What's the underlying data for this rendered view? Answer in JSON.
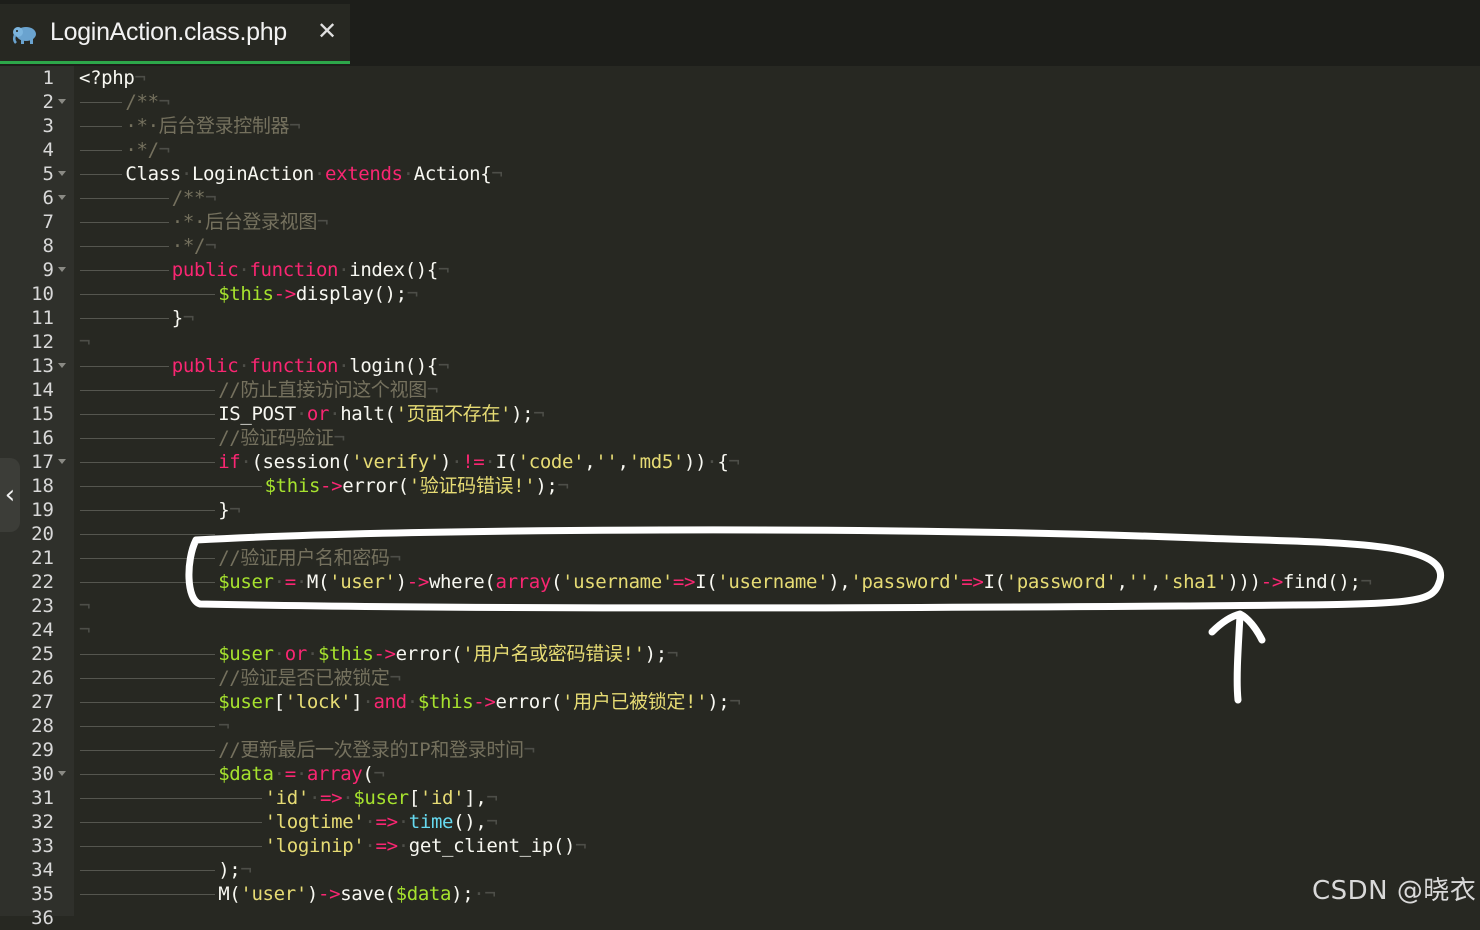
{
  "tab": {
    "title": "LoginAction.class.php",
    "close_label": "✕",
    "icon": "php-elephant-icon"
  },
  "side_handle": "‹",
  "watermark": "CSDN @晓衣",
  "colors": {
    "background": "#272822",
    "keyword": "#f92672",
    "variable": "#a6e22e",
    "string": "#e6db74",
    "comment": "#75715e",
    "builtin": "#66d9ef",
    "tab_underline": "#2da74a",
    "annotation": "#ffffff"
  },
  "editor": {
    "lines": [
      {
        "n": "1",
        "fold": false,
        "guide": 0,
        "tokens": [
          [
            "p",
            "<?php"
          ],
          [
            "w",
            "¬"
          ]
        ]
      },
      {
        "n": "2",
        "fold": true,
        "guide": 4,
        "tokens": [
          [
            "c",
            "/**"
          ],
          [
            "w",
            "¬"
          ]
        ]
      },
      {
        "n": "3",
        "fold": false,
        "guide": 4,
        "tokens": [
          [
            "c",
            "·*·后台登录控制器"
          ],
          [
            "w",
            "¬"
          ]
        ]
      },
      {
        "n": "4",
        "fold": false,
        "guide": 4,
        "tokens": [
          [
            "c",
            "·*/"
          ],
          [
            "w",
            "¬"
          ]
        ]
      },
      {
        "n": "5",
        "fold": true,
        "guide": 4,
        "tokens": [
          [
            "p",
            "Class"
          ],
          [
            "w",
            "·"
          ],
          [
            "p",
            "LoginAction"
          ],
          [
            "w",
            "·"
          ],
          [
            "k",
            "extends"
          ],
          [
            "w",
            "·"
          ],
          [
            "p",
            "Action{"
          ],
          [
            "w",
            "¬"
          ]
        ]
      },
      {
        "n": "6",
        "fold": true,
        "guide": 8,
        "tokens": [
          [
            "c",
            "/**"
          ],
          [
            "w",
            "¬"
          ]
        ]
      },
      {
        "n": "7",
        "fold": false,
        "guide": 8,
        "tokens": [
          [
            "c",
            "·*·后台登录视图"
          ],
          [
            "w",
            "¬"
          ]
        ]
      },
      {
        "n": "8",
        "fold": false,
        "guide": 8,
        "tokens": [
          [
            "c",
            "·*/"
          ],
          [
            "w",
            "¬"
          ]
        ]
      },
      {
        "n": "9",
        "fold": true,
        "guide": 8,
        "tokens": [
          [
            "k",
            "public"
          ],
          [
            "w",
            "·"
          ],
          [
            "k",
            "function"
          ],
          [
            "w",
            "·"
          ],
          [
            "p",
            "index(){"
          ],
          [
            "w",
            "¬"
          ]
        ]
      },
      {
        "n": "10",
        "fold": false,
        "guide": 12,
        "tokens": [
          [
            "v",
            "$this"
          ],
          [
            "k",
            "->"
          ],
          [
            "p",
            "display();"
          ],
          [
            "w",
            "¬"
          ]
        ]
      },
      {
        "n": "11",
        "fold": false,
        "guide": 8,
        "tokens": [
          [
            "p",
            "}"
          ],
          [
            "w",
            "¬"
          ]
        ]
      },
      {
        "n": "12",
        "fold": false,
        "guide": 0,
        "tokens": [
          [
            "w",
            "¬"
          ]
        ]
      },
      {
        "n": "13",
        "fold": true,
        "guide": 8,
        "tokens": [
          [
            "k",
            "public"
          ],
          [
            "w",
            "·"
          ],
          [
            "k",
            "function"
          ],
          [
            "w",
            "·"
          ],
          [
            "p",
            "login(){"
          ],
          [
            "w",
            "¬"
          ]
        ]
      },
      {
        "n": "14",
        "fold": false,
        "guide": 12,
        "tokens": [
          [
            "c",
            "//防止直接访问这个视图"
          ],
          [
            "w",
            "¬"
          ]
        ]
      },
      {
        "n": "15",
        "fold": false,
        "guide": 12,
        "tokens": [
          [
            "p",
            "IS_POST"
          ],
          [
            "w",
            "·"
          ],
          [
            "k",
            "or"
          ],
          [
            "w",
            "·"
          ],
          [
            "p",
            "halt("
          ],
          [
            "s",
            "'页面不存在'"
          ],
          [
            "p",
            ");"
          ],
          [
            "w",
            "¬"
          ]
        ]
      },
      {
        "n": "16",
        "fold": false,
        "guide": 12,
        "tokens": [
          [
            "c",
            "//验证码验证"
          ],
          [
            "w",
            "¬"
          ]
        ]
      },
      {
        "n": "17",
        "fold": true,
        "guide": 12,
        "tokens": [
          [
            "k",
            "if"
          ],
          [
            "w",
            "·"
          ],
          [
            "p",
            "(session("
          ],
          [
            "s",
            "'verify'"
          ],
          [
            "p",
            ")"
          ],
          [
            "w",
            "·"
          ],
          [
            "k",
            "!="
          ],
          [
            "w",
            "·"
          ],
          [
            "p",
            "I("
          ],
          [
            "s",
            "'code'"
          ],
          [
            "p",
            ","
          ],
          [
            "s",
            "''"
          ],
          [
            "p",
            ","
          ],
          [
            "s",
            "'md5'"
          ],
          [
            "p",
            "))"
          ],
          [
            "w",
            "·"
          ],
          [
            "p",
            "{"
          ],
          [
            "w",
            "¬"
          ]
        ]
      },
      {
        "n": "18",
        "fold": false,
        "guide": 16,
        "tokens": [
          [
            "v",
            "$this"
          ],
          [
            "k",
            "->"
          ],
          [
            "p",
            "error("
          ],
          [
            "s",
            "'验证码错误!'"
          ],
          [
            "p",
            ");"
          ],
          [
            "w",
            "¬"
          ]
        ]
      },
      {
        "n": "19",
        "fold": false,
        "guide": 12,
        "tokens": [
          [
            "p",
            "}"
          ],
          [
            "w",
            "¬"
          ]
        ]
      },
      {
        "n": "20",
        "fold": false,
        "guide": 12,
        "tokens": []
      },
      {
        "n": "21",
        "fold": false,
        "guide": 12,
        "tokens": [
          [
            "c",
            "//验证用户名和密码"
          ],
          [
            "w",
            "¬"
          ]
        ]
      },
      {
        "n": "22",
        "fold": false,
        "guide": 12,
        "tokens": [
          [
            "v",
            "$user"
          ],
          [
            "w",
            "·"
          ],
          [
            "k",
            "="
          ],
          [
            "w",
            "·"
          ],
          [
            "p",
            "M("
          ],
          [
            "s",
            "'user'"
          ],
          [
            "p",
            ")"
          ],
          [
            "k",
            "->"
          ],
          [
            "p",
            "where("
          ],
          [
            "k",
            "array"
          ],
          [
            "p",
            "("
          ],
          [
            "s",
            "'username'"
          ],
          [
            "k",
            "=>"
          ],
          [
            "p",
            "I("
          ],
          [
            "s",
            "'username'"
          ],
          [
            "p",
            "),"
          ],
          [
            "s",
            "'password'"
          ],
          [
            "k",
            "=>"
          ],
          [
            "p",
            "I("
          ],
          [
            "s",
            "'password'"
          ],
          [
            "p",
            ","
          ],
          [
            "s",
            "''"
          ],
          [
            "p",
            ","
          ],
          [
            "s",
            "'sha1'"
          ],
          [
            "p",
            ")))"
          ],
          [
            "k",
            "->"
          ],
          [
            "p",
            "find();"
          ],
          [
            "w",
            "¬"
          ]
        ]
      },
      {
        "n": "23",
        "fold": false,
        "guide": 0,
        "tokens": [
          [
            "w",
            "¬"
          ]
        ]
      },
      {
        "n": "24",
        "fold": false,
        "guide": 0,
        "tokens": [
          [
            "w",
            "¬"
          ]
        ]
      },
      {
        "n": "25",
        "fold": false,
        "guide": 12,
        "tokens": [
          [
            "v",
            "$user"
          ],
          [
            "w",
            "·"
          ],
          [
            "k",
            "or"
          ],
          [
            "w",
            "·"
          ],
          [
            "v",
            "$this"
          ],
          [
            "k",
            "->"
          ],
          [
            "p",
            "error("
          ],
          [
            "s",
            "'用户名或密码错误!'"
          ],
          [
            "p",
            ");"
          ],
          [
            "w",
            "¬"
          ]
        ]
      },
      {
        "n": "26",
        "fold": false,
        "guide": 12,
        "tokens": [
          [
            "c",
            "//验证是否已被锁定"
          ],
          [
            "w",
            "¬"
          ]
        ]
      },
      {
        "n": "27",
        "fold": false,
        "guide": 12,
        "tokens": [
          [
            "v",
            "$user"
          ],
          [
            "p",
            "["
          ],
          [
            "s",
            "'lock'"
          ],
          [
            "p",
            "]"
          ],
          [
            "w",
            "·"
          ],
          [
            "k",
            "and"
          ],
          [
            "w",
            "·"
          ],
          [
            "v",
            "$this"
          ],
          [
            "k",
            "->"
          ],
          [
            "p",
            "error("
          ],
          [
            "s",
            "'用户已被锁定!'"
          ],
          [
            "p",
            ");"
          ],
          [
            "w",
            "¬"
          ]
        ]
      },
      {
        "n": "28",
        "fold": false,
        "guide": 12,
        "tokens": [
          [
            "w",
            "¬"
          ]
        ]
      },
      {
        "n": "29",
        "fold": false,
        "guide": 12,
        "tokens": [
          [
            "c",
            "//更新最后一次登录的IP和登录时间"
          ],
          [
            "w",
            "¬"
          ]
        ]
      },
      {
        "n": "30",
        "fold": true,
        "guide": 12,
        "tokens": [
          [
            "v",
            "$data"
          ],
          [
            "w",
            "·"
          ],
          [
            "k",
            "="
          ],
          [
            "w",
            "·"
          ],
          [
            "k",
            "array"
          ],
          [
            "p",
            "("
          ],
          [
            "w",
            "¬"
          ]
        ]
      },
      {
        "n": "31",
        "fold": false,
        "guide": 16,
        "tokens": [
          [
            "s",
            "'id'"
          ],
          [
            "w",
            "·"
          ],
          [
            "k",
            "=>"
          ],
          [
            "w",
            "·"
          ],
          [
            "v",
            "$user"
          ],
          [
            "p",
            "["
          ],
          [
            "s",
            "'id'"
          ],
          [
            "p",
            "],"
          ],
          [
            "w",
            "¬"
          ]
        ]
      },
      {
        "n": "32",
        "fold": false,
        "guide": 16,
        "tokens": [
          [
            "s",
            "'logtime'"
          ],
          [
            "w",
            "·"
          ],
          [
            "k",
            "=>"
          ],
          [
            "w",
            "·"
          ],
          [
            "f",
            "time"
          ],
          [
            "p",
            "(),"
          ],
          [
            "w",
            "¬"
          ]
        ]
      },
      {
        "n": "33",
        "fold": false,
        "guide": 16,
        "tokens": [
          [
            "s",
            "'loginip'"
          ],
          [
            "w",
            "·"
          ],
          [
            "k",
            "=>"
          ],
          [
            "w",
            "·"
          ],
          [
            "p",
            "get_client_ip()"
          ],
          [
            "w",
            "¬"
          ]
        ]
      },
      {
        "n": "34",
        "fold": false,
        "guide": 12,
        "tokens": [
          [
            "p",
            ");"
          ],
          [
            "w",
            "¬"
          ]
        ]
      },
      {
        "n": "35",
        "fold": false,
        "guide": 12,
        "tokens": [
          [
            "p",
            "M("
          ],
          [
            "s",
            "'user'"
          ],
          [
            "p",
            ")"
          ],
          [
            "k",
            "->"
          ],
          [
            "p",
            "save("
          ],
          [
            "v",
            "$data"
          ],
          [
            "p",
            ");"
          ],
          [
            "w",
            "·¬"
          ]
        ]
      },
      {
        "n": "36",
        "fold": false,
        "guide": 0,
        "tokens": []
      }
    ]
  }
}
